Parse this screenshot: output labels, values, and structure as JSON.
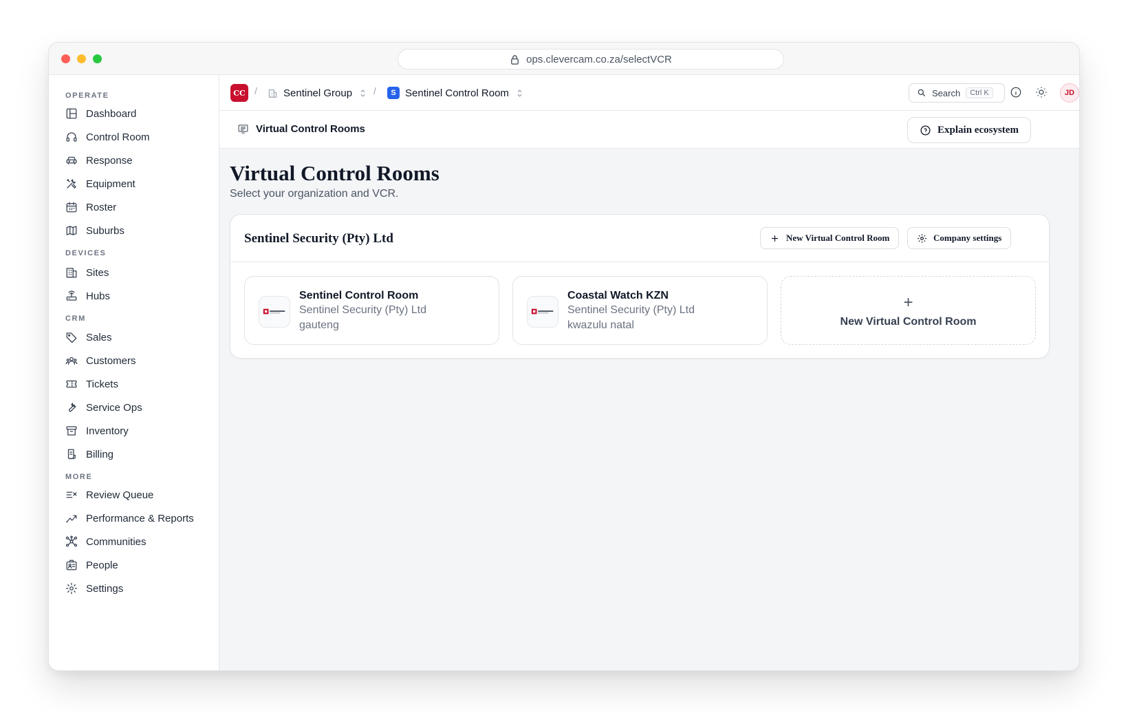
{
  "browser": {
    "url": "ops.clevercam.co.za/selectVCR"
  },
  "sidebar": {
    "sections": [
      {
        "label": "OPERATE",
        "items": [
          "Dashboard",
          "Control Room",
          "Response",
          "Equipment",
          "Roster",
          "Suburbs"
        ]
      },
      {
        "label": "DEVICES",
        "items": [
          "Sites",
          "Hubs"
        ]
      },
      {
        "label": "CRM",
        "items": [
          "Sales",
          "Customers",
          "Tickets",
          "Service Ops",
          "Inventory",
          "Billing"
        ]
      },
      {
        "label": "MORE",
        "items": [
          "Review Queue",
          "Performance & Reports",
          "Communities",
          "People",
          "Settings"
        ]
      }
    ]
  },
  "topbar": {
    "logo_text": "CC",
    "separator": "/",
    "group_name": "Sentinel Group",
    "room_badge": "S",
    "room_name": "Sentinel Control Room",
    "search_label": "Search",
    "search_shortcut": "Ctrl K",
    "avatar_initials": "JD"
  },
  "pagebar": {
    "title": "Virtual Control Rooms",
    "explain_label": "Explain ecosystem"
  },
  "main": {
    "heading": "Virtual Control Rooms",
    "subheading": "Select your organization and VCR.",
    "company": {
      "name": "Sentinel Security (Pty) Ltd",
      "new_vcr_label": "New Virtual Control Room",
      "settings_label": "Company settings",
      "vcrs": [
        {
          "name": "Sentinel Control Room",
          "org": "Sentinel Security (Pty) Ltd",
          "region": "gauteng"
        },
        {
          "name": "Coastal Watch KZN",
          "org": "Sentinel Security (Pty) Ltd",
          "region": "kwazulu natal"
        }
      ],
      "new_card": {
        "plus": "+",
        "label": "New Virtual Control Room"
      }
    }
  },
  "colors": {
    "brand_red": "#c8102e",
    "accent_blue": "#2563eb"
  }
}
